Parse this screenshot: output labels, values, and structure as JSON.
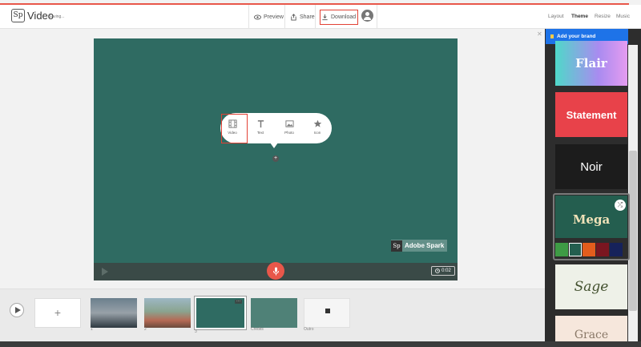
{
  "header": {
    "logo_text": "Sp",
    "app_title": "Video",
    "status": "Saving...",
    "preview_label": "Preview",
    "share_label": "Share",
    "download_label": "Download"
  },
  "right_tabs": [
    {
      "label": "Layout",
      "active": false
    },
    {
      "label": "Theme",
      "active": true
    },
    {
      "label": "Resize",
      "active": false
    },
    {
      "label": "Music",
      "active": false
    }
  ],
  "insert_popup": {
    "items": [
      {
        "label": "Video",
        "icon": "film-icon"
      },
      {
        "label": "Text",
        "icon": "text-icon"
      },
      {
        "label": "Photo",
        "icon": "image-icon"
      },
      {
        "label": "Icon",
        "icon": "star-icon"
      }
    ]
  },
  "stage": {
    "watermark_logo": "Sp",
    "watermark_text": "Adobe Spark",
    "duration": "0:02",
    "background": "#2f6b62"
  },
  "timeline": {
    "add_label": "+",
    "slides": [
      {
        "label": "1"
      },
      {
        "label": "2"
      },
      {
        "label": "3"
      },
      {
        "label": "Credits"
      },
      {
        "label": "Outro"
      }
    ]
  },
  "themes_panel": {
    "brand_label": "Add your brand",
    "themes": [
      {
        "name": "Flair"
      },
      {
        "name": "Statement"
      },
      {
        "name": "Noir"
      },
      {
        "name": "Mega"
      },
      {
        "name": "Sage"
      },
      {
        "name": "Grace"
      }
    ],
    "mega_swatches": [
      "#3e9b45",
      "#245e4f",
      "#e35d1d",
      "#7a1620",
      "#16225a"
    ]
  },
  "colors": {
    "accent": "#e8574a",
    "highlight_box": "#e24135",
    "brand_blue": "#1e73e8"
  }
}
